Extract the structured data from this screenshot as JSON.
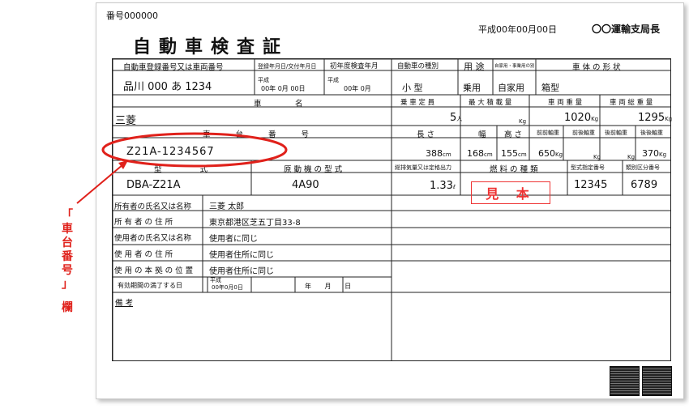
{
  "header": {
    "doc_number": "番号000000",
    "title": "自動車検査証",
    "issue_date": "平成00年00月00日",
    "office": "〇〇運輸支局長"
  },
  "row1": {
    "reg_label": "自動車登録番号又は車両番号",
    "reg_value": "品川 000 あ 1234",
    "reg_date_label": "登録年月日/交付年月日",
    "reg_date_era": "平成",
    "reg_date_value": "00年 0月 00日",
    "first_reg_label": "初年度検査年月",
    "first_reg_era": "平成",
    "first_reg_value": "00年 0月",
    "vehicle_kind_label": "自動車の種別",
    "vehicle_kind_value": "小 型",
    "usage_label": "用 途",
    "usage_value": "乗用",
    "private_label": "自家用・事業用の別",
    "private_value": "自家用",
    "body_label": "車 体 の 形 状",
    "body_value": "箱型"
  },
  "row2": {
    "maker_label_a": "車",
    "maker_label_b": "名",
    "maker_value": "三菱",
    "capacity_label": "乗 車 定 員",
    "capacity_value": "5",
    "capacity_unit": "人",
    "max_load_label": "最 大 積 載 量",
    "max_load_value": "",
    "max_load_unit": "Kg",
    "weight_label": "車 両 重 量",
    "weight_value": "1020",
    "weight_unit": "Kg",
    "gross_label": "車 両 総 重 量",
    "gross_value": "1295",
    "gross_unit": "Kg"
  },
  "row3": {
    "chassis_label": "車 台 番 号",
    "chassis_value": "Z21A-1234567",
    "length_label": "長 さ",
    "length_value": "388",
    "width_label": "幅",
    "width_value": "168",
    "height_label": "高 さ",
    "height_value": "155",
    "cm": "cm",
    "ff_label": "前前軸重",
    "ff_value": "650",
    "fr_label": "前後軸重",
    "rf_label": "後前軸重",
    "rr_label": "後後軸重",
    "rr_value": "370",
    "kg": "Kg"
  },
  "row4": {
    "model_label": "型 式",
    "model_value": "DBA-Z21A",
    "engine_label": "原 動 機 の 型 式",
    "engine_value": "4A90",
    "displacement_label": "総排気量又は定格出力",
    "displacement_value": "1.33",
    "displacement_unit": "ℓ",
    "fuel_label": "燃 料 の 種 類",
    "type_no_label": "型式指定番号",
    "type_no_value": "12345",
    "class_no_label": "類別区分番号",
    "class_no_value": "6789"
  },
  "owners": {
    "owner_name_label": "所有者の氏名又は名称",
    "owner_name_value": "三菱 太郎",
    "owner_addr_label": "所 有 者 の 住 所",
    "owner_addr_value": "東京都港区芝五丁目33-8",
    "user_name_label": "使用者の氏名又は名称",
    "user_name_value": "使用者に同じ",
    "user_addr_label": "使 用 者 の 住 所",
    "user_addr_value": "使用者住所に同じ",
    "base_label": "使 用 の 本 拠 の 位 置",
    "base_value": "使用者住所に同じ",
    "expiry_label": "有効期間の満了する日",
    "expiry_era": "平成",
    "expiry_value": "00年0月0日",
    "expiry_blank": "年 月 日"
  },
  "remarks_label": "備 考",
  "stamp_text": "見 本",
  "annotation": {
    "text_chars": [
      "「",
      "車",
      "台",
      "番",
      "号",
      "」",
      "欄"
    ],
    "color": "#e0211b"
  }
}
